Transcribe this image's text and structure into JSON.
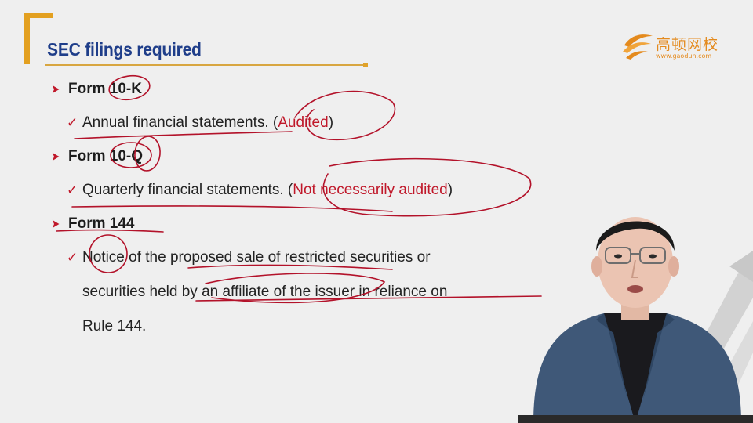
{
  "slide": {
    "title": "SEC filings required"
  },
  "logo": {
    "name": "高顿网校",
    "url": "www.gaodun.com"
  },
  "bullets": [
    {
      "form": "Form 10-K",
      "desc": "Annual financial statements.",
      "paren_open": "(",
      "highlight": "Audited",
      "paren_close": ")"
    },
    {
      "form": "Form 10-Q",
      "desc": "Quarterly financial statements.",
      "paren_open": "(",
      "highlight": "Not necessarily audited",
      "paren_close": ")"
    },
    {
      "form": "Form 144",
      "lines": [
        "Notice of the proposed sale of restricted securities or",
        "securities held by an affiliate of the issuer in reliance on",
        "Rule 144."
      ]
    }
  ],
  "colors": {
    "title": "#1f3e8a",
    "accent_orange": "#e3a020",
    "bullet_red": "#c0182a",
    "annotation_ink": "#b3122a",
    "background": "#efefef"
  },
  "icons": {
    "bullet": "arrowhead-right-icon",
    "sub_bullet": "checkmark-icon"
  }
}
